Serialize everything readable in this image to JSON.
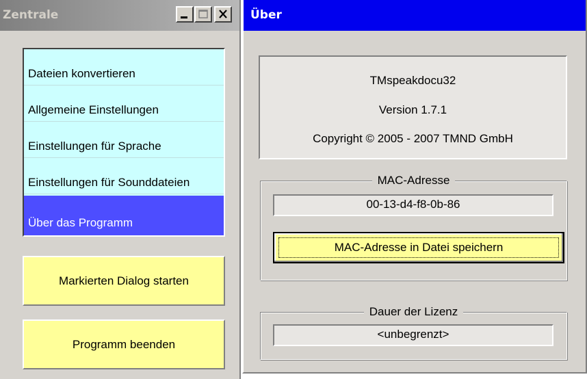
{
  "left_window": {
    "title": "Zentrale",
    "menu_items": [
      {
        "label": "Dateien konvertieren",
        "selected": false
      },
      {
        "label": "Allgemeine Einstellungen",
        "selected": false
      },
      {
        "label": "Einstellungen für Sprache",
        "selected": false
      },
      {
        "label": "Einstellungen für Sounddateien",
        "selected": false
      },
      {
        "label": "Über das Programm",
        "selected": true
      }
    ],
    "start_button": "Markierten Dialog starten",
    "exit_button": "Programm beenden"
  },
  "right_window": {
    "title": "Über",
    "product_name": "TMspeakdocu32",
    "version": "Version  1.7.1",
    "copyright": "Copyright © 2005 - 2007  TMND GmbH",
    "mac_group": {
      "label": "MAC-Adresse",
      "value": "00-13-d4-f8-0b-86",
      "save_button": "MAC-Adresse in Datei speichern"
    },
    "license_group": {
      "label": "Dauer der Lizenz",
      "value": "<unbegrenzt>"
    }
  },
  "colors": {
    "list_background": "#ccffff",
    "selected_item": "#4d4dff",
    "button_yellow": "#ffff99",
    "active_titlebar": "#0000ee",
    "inactive_titlebar": "#808080"
  },
  "icons": [
    "minimize-icon",
    "maximize-icon",
    "close-icon"
  ]
}
